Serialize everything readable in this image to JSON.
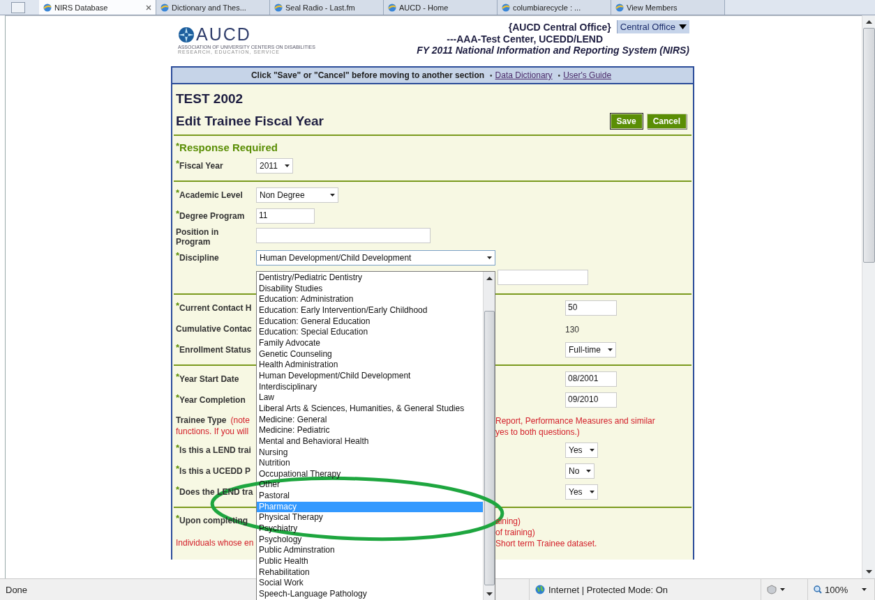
{
  "browser_tabs": [
    {
      "label": "NIRS Database",
      "selected": true
    },
    {
      "label": "Dictionary and Thes...",
      "selected": false
    },
    {
      "label": "Seal Radio - Last.fm",
      "selected": false
    },
    {
      "label": "AUCD - Home",
      "selected": false
    },
    {
      "label": "columbiarecycle : ...",
      "selected": false
    },
    {
      "label": "View Members",
      "selected": false
    }
  ],
  "header": {
    "logo": {
      "name": "AUCD",
      "tagline": "ASSOCIATION OF UNIVERSITY CENTERS ON DISABILITIES",
      "motto": "RESEARCH, EDUCATION, SERVICE"
    },
    "office": "{AUCD Central Office}",
    "center": "---AAA-Test Center, UCEDD/LEND",
    "system": "FY 2011 National Information and Reporting System (NIRS)",
    "office_select": "Central Office"
  },
  "notice_bar": {
    "text": "Click \"Save\" or \"Cancel\" before moving to another section",
    "separator": "•",
    "links": [
      "Data Dictionary",
      "User's Guide"
    ]
  },
  "record": "TEST 2002",
  "form_title": "Edit Trainee Fiscal Year",
  "buttons": [
    {
      "label": "Save",
      "default": true
    },
    {
      "label": "Cancel",
      "default": false
    }
  ],
  "sections": [
    {
      "rows": [
        {
          "kind": "heading",
          "label": "$^{*}$Response Required"
        },
        {
          "kind": "select",
          "label": "$^{*}$Fiscal Year",
          "value": "2011"
        }
      ]
    },
    {
      "rows": [
        {
          "kind": "select",
          "label": "$^{*}$Academic Level",
          "value": "Non Degree",
          "wide": true
        },
        {
          "kind": "input",
          "label": "$^{*}$Degree Program",
          "value": "11"
        },
        {
          "kind": "input",
          "label": "Position in Program",
          "wide": true
        },
        {
          "kind": "open-select",
          "label": "$^{*}$Discipline",
          "value": "Human Development/Child Development"
        },
        {
          "kind": "input"
        }
      ]
    },
    {
      "rows": [
        {
          "kind": "input",
          "label": "$^{*}$Current Contact H",
          "value": "50",
          "long_label": true
        },
        {
          "kind": "static",
          "label": "Cumulative Contac",
          "value": "130",
          "long_label": true
        },
        {
          "kind": "select",
          "label": "$^{*}$Enrollment Status",
          "value": "Full-time",
          "long_label": true
        }
      ]
    },
    {
      "rows": [
        {
          "kind": "input",
          "label": "$^{*}$Year Start Date",
          "value": "08/2001",
          "long_label": true
        },
        {
          "kind": "input",
          "label": "$^{*}$Year Completion",
          "value": "09/2010",
          "long_label": true
        },
        {
          "kind": "note",
          "label": "Trainee Type",
          "lines": [
            {
              "left": "(note",
              "side": "Report, Performance Measures and similar"
            },
            {
              "left": "functions. If you will",
              "side": "yes to both questions.)"
            }
          ]
        },
        {
          "kind": "select",
          "label": "$^{*}$Is this a LEND trai",
          "value": "Yes",
          "long_label": true
        },
        {
          "kind": "select",
          "label": "$^{*}$Is this a UCEDD P",
          "value": "No",
          "long_label": true
        },
        {
          "kind": "select",
          "label": "$^{*}$Does the LEND tra",
          "value": "Yes",
          "long_label": true
        }
      ]
    },
    {
      "rows": [
        {
          "kind": "note",
          "label": "$^{*}$Upon completing",
          "lines": [
            {
              "side": "aining)"
            },
            {
              "side": "of training)"
            },
            {
              "left": "Individuals whose en",
              "side": "Short term Trainee dataset."
            }
          ]
        }
      ]
    }
  ],
  "discipline_list": {
    "items": [
      {
        "label": "Dentistry/Pediatric Dentistry",
        "selected": false
      },
      {
        "label": "Disability Studies",
        "selected": false
      },
      {
        "label": "Education: Administration",
        "selected": false
      },
      {
        "label": "Education: Early Intervention/Early Childhood",
        "selected": false
      },
      {
        "label": "Education: General Education",
        "selected": false
      },
      {
        "label": "Education: Special Education",
        "selected": false
      },
      {
        "label": "Family Advocate",
        "selected": false
      },
      {
        "label": "Genetic Counseling",
        "selected": false
      },
      {
        "label": "Health Administration",
        "selected": false
      },
      {
        "label": "Human Development/Child Development",
        "selected": false
      },
      {
        "label": "Interdisciplinary",
        "selected": false
      },
      {
        "label": "Law",
        "selected": false
      },
      {
        "label": "Liberal Arts & Sciences, Humanities, & General Studies",
        "selected": false
      },
      {
        "label": "Medicine: General",
        "selected": false
      },
      {
        "label": "Medicine: Pediatric",
        "selected": false
      },
      {
        "label": "Mental and Behavioral Health",
        "selected": false
      },
      {
        "label": "Nursing",
        "selected": false
      },
      {
        "label": "Nutrition",
        "selected": false
      },
      {
        "label": "Occupational Therapy",
        "selected": false
      },
      {
        "label": "Other",
        "selected": false
      },
      {
        "label": "Pastoral",
        "selected": false
      },
      {
        "label": "Pharmacy",
        "selected": true
      },
      {
        "label": "Physical Therapy",
        "selected": false
      },
      {
        "label": "Psychiatry",
        "selected": false
      },
      {
        "label": "Psychology",
        "selected": false
      },
      {
        "label": "Public Adminstration",
        "selected": false
      },
      {
        "label": "Public Health",
        "selected": false
      },
      {
        "label": "Rehabilitation",
        "selected": false
      },
      {
        "label": "Social Work",
        "selected": false
      },
      {
        "label": "Speech-Language Pathology",
        "selected": false
      }
    ]
  },
  "status_bar": {
    "status": "Done",
    "zone": "Internet | Protected Mode: On",
    "zoom": "100%"
  }
}
